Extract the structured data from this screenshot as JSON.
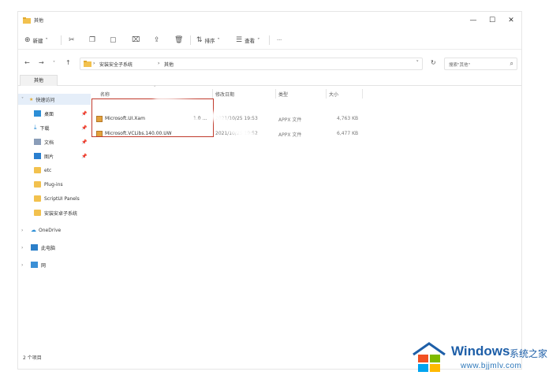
{
  "window": {
    "title": "其他",
    "controls": {
      "minimize": "—",
      "maximize": "☐",
      "close": "✕"
    }
  },
  "toolbar": {
    "new_label": "新建",
    "cut_icon": "scissors-icon",
    "copy_icon": "copy-icon",
    "paste_icon": "paste-icon",
    "rename_icon": "rename-icon",
    "share_icon": "share-icon",
    "delete_icon": "trash-icon",
    "sort_label": "排序",
    "view_label": "查看",
    "more_label": "···"
  },
  "address": {
    "breadcrumb": [
      "安装安全子系统",
      "其他"
    ],
    "search_placeholder": "搜索\"其他\""
  },
  "tabs": [
    "其他"
  ],
  "sidebar": {
    "quick_access": "快速访问",
    "items": [
      {
        "label": "桌面",
        "pinned": true,
        "icon": "desktop-folder-icon"
      },
      {
        "label": "下载",
        "pinned": true,
        "icon": "download-folder-icon"
      },
      {
        "label": "文档",
        "pinned": true,
        "icon": "documents-folder-icon"
      },
      {
        "label": "图片",
        "pinned": true,
        "icon": "pictures-folder-icon"
      },
      {
        "label": "etc",
        "pinned": false,
        "icon": "folder-icon"
      },
      {
        "label": "Plug-ins",
        "pinned": false,
        "icon": "folder-icon"
      },
      {
        "label": "ScriptUI Panels",
        "pinned": false,
        "icon": "folder-icon"
      },
      {
        "label": "安装安卓子系统",
        "pinned": false,
        "icon": "folder-icon"
      }
    ],
    "groups": [
      {
        "label": "OneDrive",
        "icon": "cloud-icon"
      },
      {
        "label": "此电脑",
        "icon": "computer-icon"
      },
      {
        "label": "网",
        "icon": "network-icon"
      }
    ]
  },
  "columns": {
    "name": "名称",
    "modified": "修改日期",
    "type": "类型",
    "size": "大小"
  },
  "files": [
    {
      "name": "Microsoft.UI.Xam",
      "name_tail": "1.0 ...",
      "modified": "2021/10/25 19:53",
      "type": "APPX 文件",
      "size": "4,763 KB"
    },
    {
      "name": "Microsoft.VCLibs.140.00.UW",
      "name_tail": "",
      "modified": "2021/10/25 19:52",
      "type": "APPX 文件",
      "size": "6,477 KB"
    }
  ],
  "status": {
    "count": "2 个项目"
  },
  "watermark": {
    "brand": "Windows",
    "cn": "系统之家",
    "url": "www.bjjmlv.com"
  },
  "colors": {
    "highlight": "#c0392b",
    "accent": "#1e5fa8",
    "folder": "#f2c14e"
  }
}
